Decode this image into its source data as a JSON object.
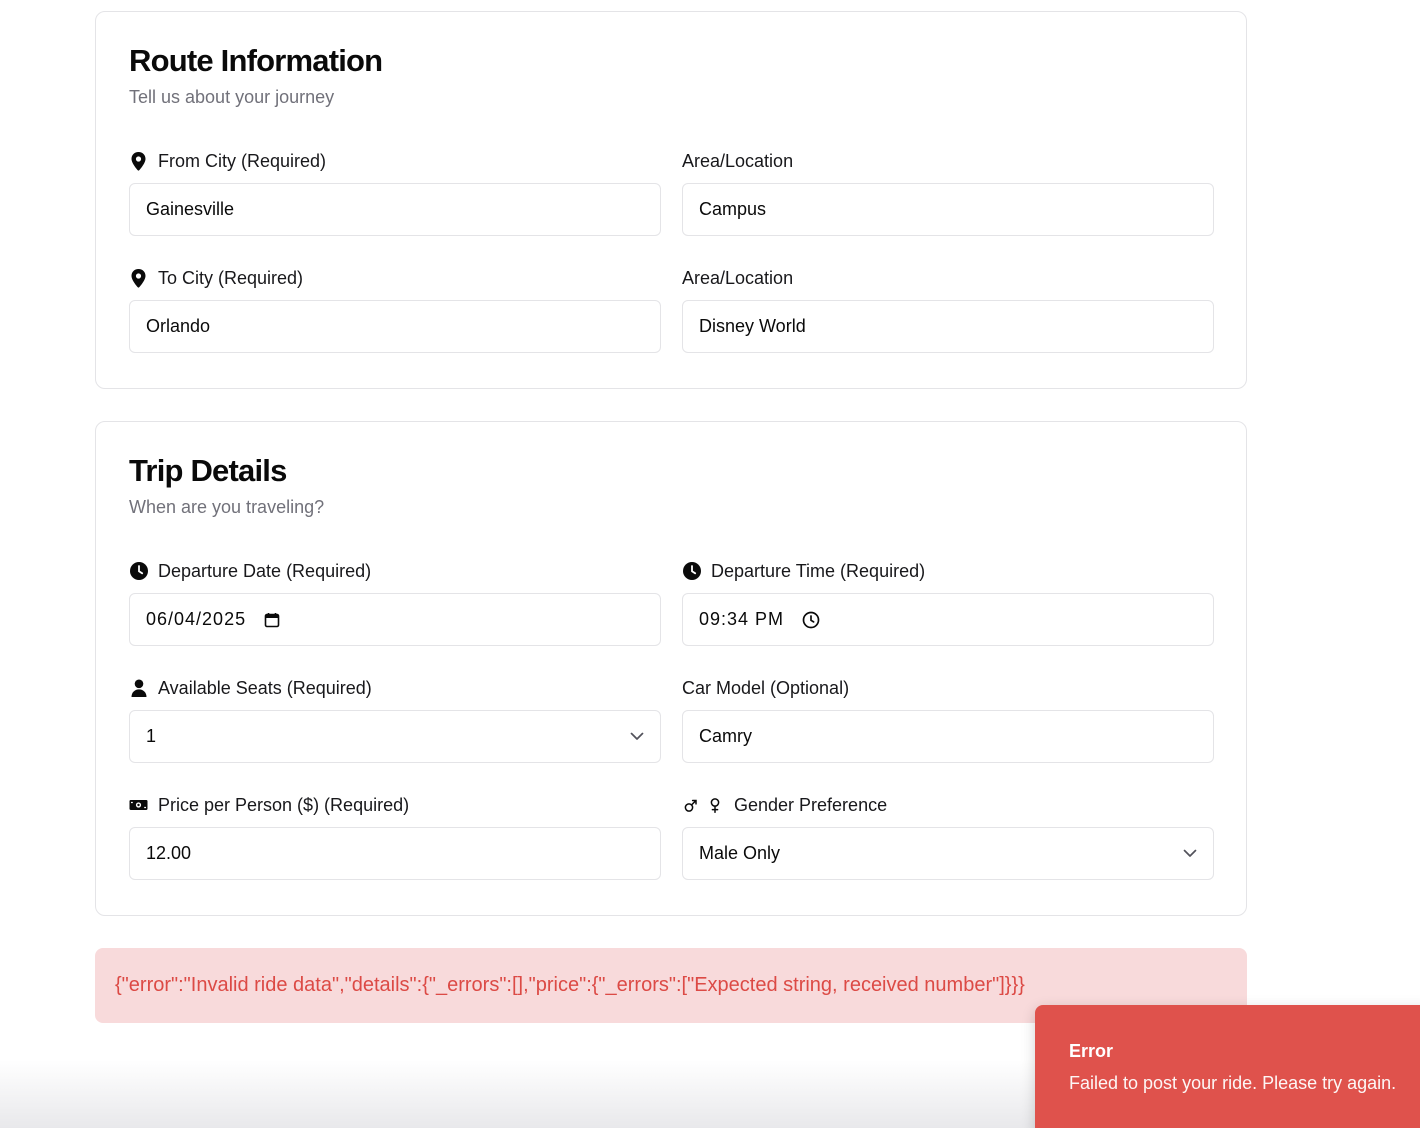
{
  "route": {
    "title": "Route Information",
    "subtitle": "Tell us about your journey",
    "from_city": {
      "label": "From City (Required)",
      "value": "Gainesville",
      "icon": "map-pin-icon"
    },
    "from_area": {
      "label": "Area/Location",
      "value": "Campus"
    },
    "to_city": {
      "label": "To City (Required)",
      "value": "Orlando",
      "icon": "map-pin-icon"
    },
    "to_area": {
      "label": "Area/Location",
      "value": "Disney World"
    }
  },
  "trip": {
    "title": "Trip Details",
    "subtitle": "When are you traveling?",
    "departure_date": {
      "label": "Departure Date (Required)",
      "value": "06/04/2025",
      "icon": "clock-icon",
      "trail_icon": "calendar-icon"
    },
    "departure_time": {
      "label": "Departure Time (Required)",
      "value": "09:34 PM",
      "icon": "clock-icon",
      "trail_icon": "clock-icon"
    },
    "seats": {
      "label": "Available Seats (Required)",
      "value": "1",
      "icon": "user-icon"
    },
    "car_model": {
      "label": "Car Model (Optional)",
      "value": "Camry"
    },
    "price": {
      "label": "Price per Person ($) (Required)",
      "value": "12.00",
      "icon": "money-icon"
    },
    "gender": {
      "label": "Gender Preference",
      "value": "Male Only",
      "icon": "gender-icon"
    }
  },
  "error_banner": {
    "text": "{\"error\":\"Invalid ride data\",\"details\":{\"_errors\":[],\"price\":{\"_errors\":[\"Expected string, received number\"]}}}"
  },
  "toast": {
    "title": "Error",
    "message": "Failed to post your ride. Please try again."
  },
  "colors": {
    "error_bg": "#f8dadb",
    "error_text": "#dc4a45",
    "toast_bg": "#df524c",
    "muted_text": "#71717a",
    "border": "#e4e4e7"
  }
}
